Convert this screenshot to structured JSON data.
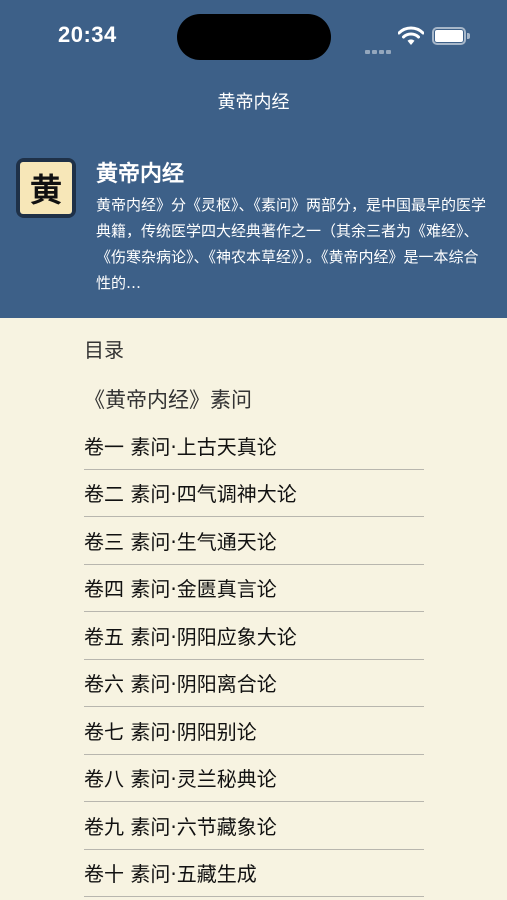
{
  "status": {
    "time": "20:34"
  },
  "nav": {
    "title": "黄帝内经"
  },
  "book": {
    "icon_char": "黄",
    "title": "黄帝内经",
    "description": "黄帝内经》分《灵枢》、《素问》两部分，是中国最早的医学典籍，传统医学四大经典著作之一（其余三者为《难经》、《伤寒杂病论》、《神农本草经》）。《黄帝内经》是一本综合性的…"
  },
  "toc": {
    "label": "目录",
    "section_title": "《黄帝内经》素问",
    "chapters": [
      "卷一 素问·上古天真论",
      "卷二 素问·四气调神大论",
      "卷三 素问·生气通天论",
      "卷四 素问·金匮真言论",
      "卷五 素问·阴阳应象大论",
      "卷六 素问·阴阳离合论",
      "卷七 素问·阴阳别论",
      "卷八 素问·灵兰秘典论",
      "卷九 素问·六节藏象论",
      "卷十 素问·五藏生成"
    ]
  },
  "colors": {
    "header_bg": "#3d6088",
    "page_bg": "#f7f3e1",
    "icon_bg": "#f7e7b8"
  },
  "icons": {
    "signal": "cellular-signal-icon",
    "wifi": "wifi-icon",
    "battery": "battery-icon"
  }
}
